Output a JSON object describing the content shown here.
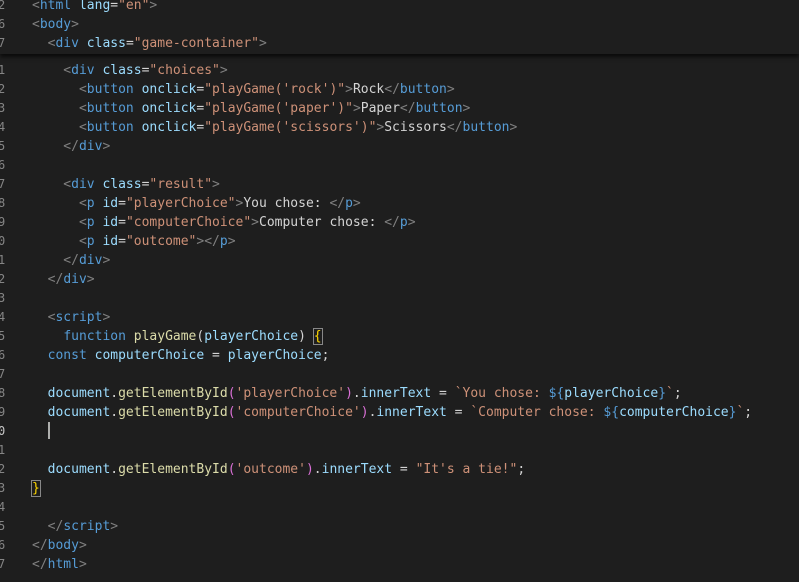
{
  "editor": {
    "sticky_lines": [
      {
        "num": "2",
        "tokens": [
          {
            "t": "<",
            "c": "ang"
          },
          {
            "t": "html",
            "c": "tag"
          },
          {
            "t": " ",
            "c": "txt"
          },
          {
            "t": "lang",
            "c": "attr"
          },
          {
            "t": "=",
            "c": "eq"
          },
          {
            "t": "\"en\"",
            "c": "str"
          },
          {
            "t": ">",
            "c": "ang"
          }
        ]
      },
      {
        "num": "6",
        "tokens": [
          {
            "t": "<",
            "c": "ang"
          },
          {
            "t": "body",
            "c": "tag"
          },
          {
            "t": ">",
            "c": "ang"
          }
        ]
      },
      {
        "num": "7",
        "tokens": [
          {
            "t": "  <",
            "c": "ang"
          },
          {
            "t": "div",
            "c": "tag"
          },
          {
            "t": " ",
            "c": "txt"
          },
          {
            "t": "class",
            "c": "attr"
          },
          {
            "t": "=",
            "c": "eq"
          },
          {
            "t": "\"game-container\"",
            "c": "str"
          },
          {
            "t": ">",
            "c": "ang"
          }
        ]
      }
    ],
    "lines": [
      {
        "num": "1",
        "tokens": [
          {
            "t": "    <",
            "c": "ang"
          },
          {
            "t": "div",
            "c": "tag"
          },
          {
            "t": " ",
            "c": "txt"
          },
          {
            "t": "class",
            "c": "attr"
          },
          {
            "t": "=",
            "c": "eq"
          },
          {
            "t": "\"choices\"",
            "c": "str"
          },
          {
            "t": ">",
            "c": "ang"
          }
        ]
      },
      {
        "num": "2",
        "tokens": [
          {
            "t": "      <",
            "c": "ang"
          },
          {
            "t": "button",
            "c": "tag"
          },
          {
            "t": " ",
            "c": "txt"
          },
          {
            "t": "onclick",
            "c": "attr"
          },
          {
            "t": "=",
            "c": "eq"
          },
          {
            "t": "\"playGame('rock')\"",
            "c": "str"
          },
          {
            "t": ">",
            "c": "ang"
          },
          {
            "t": "Rock",
            "c": "txt"
          },
          {
            "t": "</",
            "c": "ang"
          },
          {
            "t": "button",
            "c": "tag"
          },
          {
            "t": ">",
            "c": "ang"
          }
        ]
      },
      {
        "num": "3",
        "tokens": [
          {
            "t": "      <",
            "c": "ang"
          },
          {
            "t": "button",
            "c": "tag"
          },
          {
            "t": " ",
            "c": "txt"
          },
          {
            "t": "onclick",
            "c": "attr"
          },
          {
            "t": "=",
            "c": "eq"
          },
          {
            "t": "\"playGame('paper')\"",
            "c": "str"
          },
          {
            "t": ">",
            "c": "ang"
          },
          {
            "t": "Paper",
            "c": "txt"
          },
          {
            "t": "</",
            "c": "ang"
          },
          {
            "t": "button",
            "c": "tag"
          },
          {
            "t": ">",
            "c": "ang"
          }
        ]
      },
      {
        "num": "4",
        "tokens": [
          {
            "t": "      <",
            "c": "ang"
          },
          {
            "t": "button",
            "c": "tag"
          },
          {
            "t": " ",
            "c": "txt"
          },
          {
            "t": "onclick",
            "c": "attr"
          },
          {
            "t": "=",
            "c": "eq"
          },
          {
            "t": "\"playGame('scissors')\"",
            "c": "str"
          },
          {
            "t": ">",
            "c": "ang"
          },
          {
            "t": "Scissors",
            "c": "txt"
          },
          {
            "t": "</",
            "c": "ang"
          },
          {
            "t": "button",
            "c": "tag"
          },
          {
            "t": ">",
            "c": "ang"
          }
        ]
      },
      {
        "num": "5",
        "tokens": [
          {
            "t": "    </",
            "c": "ang"
          },
          {
            "t": "div",
            "c": "tag"
          },
          {
            "t": ">",
            "c": "ang"
          }
        ]
      },
      {
        "num": "6",
        "tokens": []
      },
      {
        "num": "7",
        "tokens": [
          {
            "t": "    <",
            "c": "ang"
          },
          {
            "t": "div",
            "c": "tag"
          },
          {
            "t": " ",
            "c": "txt"
          },
          {
            "t": "class",
            "c": "attr"
          },
          {
            "t": "=",
            "c": "eq"
          },
          {
            "t": "\"result\"",
            "c": "str"
          },
          {
            "t": ">",
            "c": "ang"
          }
        ]
      },
      {
        "num": "8",
        "tokens": [
          {
            "t": "      <",
            "c": "ang"
          },
          {
            "t": "p",
            "c": "tag"
          },
          {
            "t": " ",
            "c": "txt"
          },
          {
            "t": "id",
            "c": "attr"
          },
          {
            "t": "=",
            "c": "eq"
          },
          {
            "t": "\"playerChoice\"",
            "c": "str"
          },
          {
            "t": ">",
            "c": "ang"
          },
          {
            "t": "You chose: ",
            "c": "txt"
          },
          {
            "t": "</",
            "c": "ang"
          },
          {
            "t": "p",
            "c": "tag"
          },
          {
            "t": ">",
            "c": "ang"
          }
        ]
      },
      {
        "num": "9",
        "tokens": [
          {
            "t": "      <",
            "c": "ang"
          },
          {
            "t": "p",
            "c": "tag"
          },
          {
            "t": " ",
            "c": "txt"
          },
          {
            "t": "id",
            "c": "attr"
          },
          {
            "t": "=",
            "c": "eq"
          },
          {
            "t": "\"computerChoice\"",
            "c": "str"
          },
          {
            "t": ">",
            "c": "ang"
          },
          {
            "t": "Computer chose: ",
            "c": "txt"
          },
          {
            "t": "</",
            "c": "ang"
          },
          {
            "t": "p",
            "c": "tag"
          },
          {
            "t": ">",
            "c": "ang"
          }
        ]
      },
      {
        "num": "0",
        "tokens": [
          {
            "t": "      <",
            "c": "ang"
          },
          {
            "t": "p",
            "c": "tag"
          },
          {
            "t": " ",
            "c": "txt"
          },
          {
            "t": "id",
            "c": "attr"
          },
          {
            "t": "=",
            "c": "eq"
          },
          {
            "t": "\"outcome\"",
            "c": "str"
          },
          {
            "t": "></",
            "c": "ang"
          },
          {
            "t": "p",
            "c": "tag"
          },
          {
            "t": ">",
            "c": "ang"
          }
        ]
      },
      {
        "num": "1",
        "tokens": [
          {
            "t": "    </",
            "c": "ang"
          },
          {
            "t": "div",
            "c": "tag"
          },
          {
            "t": ">",
            "c": "ang"
          }
        ]
      },
      {
        "num": "2",
        "tokens": [
          {
            "t": "  </",
            "c": "ang"
          },
          {
            "t": "div",
            "c": "tag"
          },
          {
            "t": ">",
            "c": "ang"
          }
        ]
      },
      {
        "num": "3",
        "tokens": []
      },
      {
        "num": "4",
        "tokens": [
          {
            "t": "  <",
            "c": "ang"
          },
          {
            "t": "script",
            "c": "tag"
          },
          {
            "t": ">",
            "c": "ang"
          }
        ]
      },
      {
        "num": "5",
        "tokens": [
          {
            "t": "    ",
            "c": "txt"
          },
          {
            "t": "function",
            "c": "kw"
          },
          {
            "t": " ",
            "c": "txt"
          },
          {
            "t": "playGame",
            "c": "fn"
          },
          {
            "t": "(",
            "c": "pun"
          },
          {
            "t": "playerChoice",
            "c": "var"
          },
          {
            "t": ") ",
            "c": "pun"
          },
          {
            "t": "{",
            "c": "brk",
            "box": true
          }
        ]
      },
      {
        "num": "6",
        "tokens": [
          {
            "t": "  ",
            "c": "txt"
          },
          {
            "t": "const",
            "c": "kw"
          },
          {
            "t": " ",
            "c": "txt"
          },
          {
            "t": "computerChoice",
            "c": "var"
          },
          {
            "t": " = ",
            "c": "pun"
          },
          {
            "t": "playerChoice",
            "c": "var"
          },
          {
            "t": ";",
            "c": "pun"
          }
        ]
      },
      {
        "num": "7",
        "tokens": []
      },
      {
        "num": "8",
        "tokens": [
          {
            "t": "  ",
            "c": "txt"
          },
          {
            "t": "document",
            "c": "var"
          },
          {
            "t": ".",
            "c": "pun"
          },
          {
            "t": "getElementById",
            "c": "fn"
          },
          {
            "t": "(",
            "c": "brk2"
          },
          {
            "t": "'playerChoice'",
            "c": "str"
          },
          {
            "t": ")",
            "c": "brk2"
          },
          {
            "t": ".",
            "c": "pun"
          },
          {
            "t": "innerText",
            "c": "var"
          },
          {
            "t": " = ",
            "c": "pun"
          },
          {
            "t": "`You chose: ",
            "c": "tmpl"
          },
          {
            "t": "${",
            "c": "interp"
          },
          {
            "t": "playerChoice",
            "c": "var"
          },
          {
            "t": "}",
            "c": "interp"
          },
          {
            "t": "`",
            "c": "tmpl"
          },
          {
            "t": ";",
            "c": "pun"
          }
        ]
      },
      {
        "num": "9",
        "tokens": [
          {
            "t": "  ",
            "c": "txt"
          },
          {
            "t": "document",
            "c": "var"
          },
          {
            "t": ".",
            "c": "pun"
          },
          {
            "t": "getElementById",
            "c": "fn"
          },
          {
            "t": "(",
            "c": "brk2"
          },
          {
            "t": "'computerChoice'",
            "c": "str"
          },
          {
            "t": ")",
            "c": "brk2"
          },
          {
            "t": ".",
            "c": "pun"
          },
          {
            "t": "innerText",
            "c": "var"
          },
          {
            "t": " = ",
            "c": "pun"
          },
          {
            "t": "`Computer chose: ",
            "c": "tmpl"
          },
          {
            "t": "${",
            "c": "interp"
          },
          {
            "t": "computerChoice",
            "c": "var"
          },
          {
            "t": "}",
            "c": "interp"
          },
          {
            "t": "`",
            "c": "tmpl"
          },
          {
            "t": ";",
            "c": "pun"
          }
        ]
      },
      {
        "num": "0",
        "active": true,
        "cursor": true,
        "tokens": [
          {
            "t": "  ",
            "c": "txt"
          }
        ]
      },
      {
        "num": "1",
        "tokens": []
      },
      {
        "num": "2",
        "tokens": [
          {
            "t": "  ",
            "c": "txt"
          },
          {
            "t": "document",
            "c": "var"
          },
          {
            "t": ".",
            "c": "pun"
          },
          {
            "t": "getElementById",
            "c": "fn"
          },
          {
            "t": "(",
            "c": "brk2"
          },
          {
            "t": "'outcome'",
            "c": "str"
          },
          {
            "t": ")",
            "c": "brk2"
          },
          {
            "t": ".",
            "c": "pun"
          },
          {
            "t": "innerText",
            "c": "var"
          },
          {
            "t": " = ",
            "c": "pun"
          },
          {
            "t": "\"It's a tie!\"",
            "c": "str"
          },
          {
            "t": ";",
            "c": "pun"
          }
        ]
      },
      {
        "num": "3",
        "tokens": [
          {
            "t": "}",
            "c": "brk",
            "box": true
          }
        ]
      },
      {
        "num": "4",
        "tokens": []
      },
      {
        "num": "5",
        "tokens": [
          {
            "t": "  </",
            "c": "ang"
          },
          {
            "t": "script",
            "c": "tag"
          },
          {
            "t": ">",
            "c": "ang"
          }
        ]
      },
      {
        "num": "6",
        "tokens": [
          {
            "t": "</",
            "c": "ang"
          },
          {
            "t": "body",
            "c": "tag"
          },
          {
            "t": ">",
            "c": "ang"
          }
        ]
      },
      {
        "num": "7",
        "tokens": [
          {
            "t": "</",
            "c": "ang"
          },
          {
            "t": "html",
            "c": "tag"
          },
          {
            "t": ">",
            "c": "ang"
          }
        ]
      }
    ]
  }
}
